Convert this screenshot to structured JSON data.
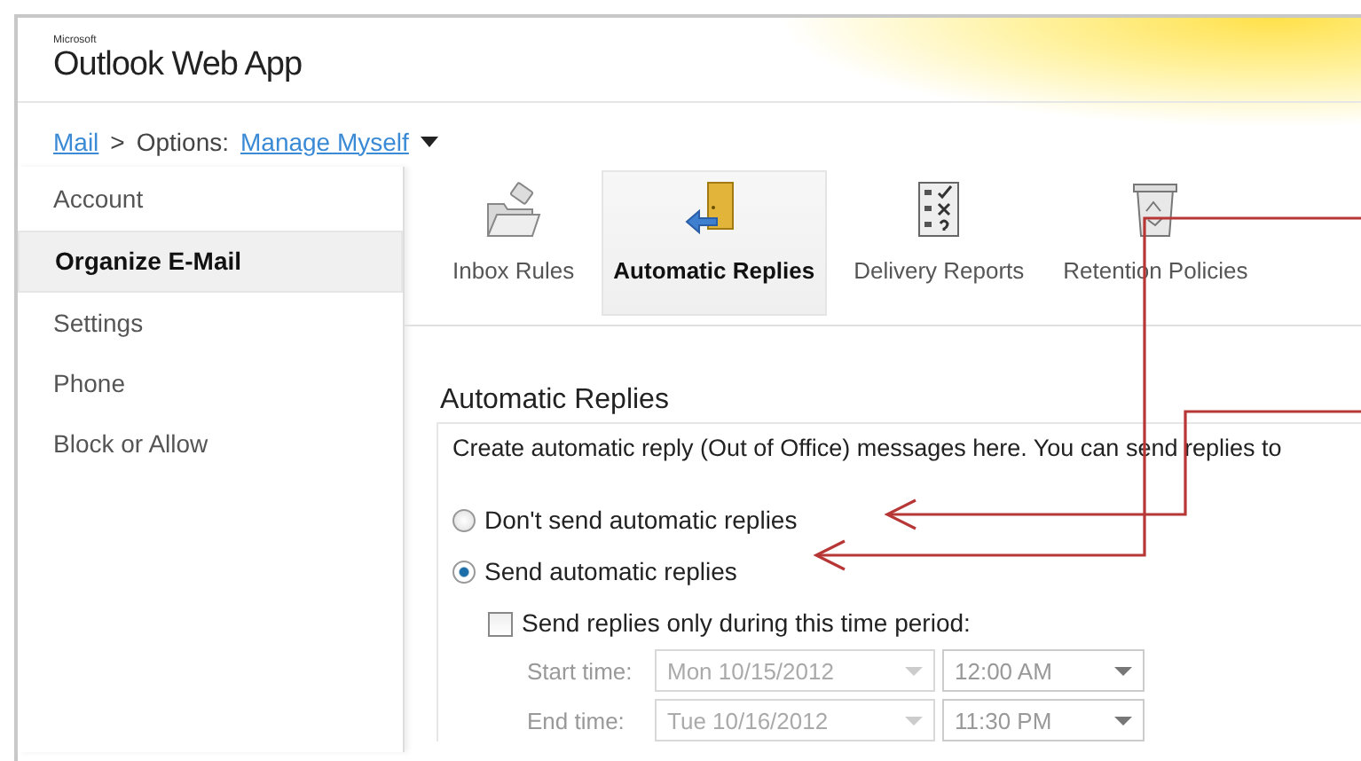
{
  "header": {
    "brand_small": "Microsoft",
    "brand": "Outlook Web App"
  },
  "breadcrumb": {
    "home": "Mail",
    "separator": ">",
    "label": "Options:",
    "current": "Manage Myself"
  },
  "sidebar": {
    "items": [
      {
        "label": "Account",
        "selected": false
      },
      {
        "label": "Organize E-Mail",
        "selected": true
      },
      {
        "label": "Settings",
        "selected": false
      },
      {
        "label": "Phone",
        "selected": false
      },
      {
        "label": "Block or Allow",
        "selected": false
      }
    ]
  },
  "toolbar": {
    "items": [
      {
        "label": "Inbox Rules",
        "kind": "folder",
        "selected": false
      },
      {
        "label": "Automatic Replies",
        "kind": "door",
        "selected": true
      },
      {
        "label": "Delivery Reports",
        "kind": "checklist",
        "selected": false
      },
      {
        "label": "Retention Policies",
        "kind": "bin",
        "selected": false
      }
    ]
  },
  "section": {
    "title": "Automatic Replies",
    "description": "Create automatic reply (Out of Office) messages here. You can send replies to",
    "options": [
      {
        "label": "Don't send automatic replies",
        "selected": false
      },
      {
        "label": "Send automatic replies",
        "selected": true
      }
    ],
    "time_period": {
      "label": "Send replies only during this time period:",
      "checked": false,
      "rows": [
        {
          "label": "Start time:",
          "date": "Mon 10/15/2012",
          "time": "12:00 AM",
          "disabled": true
        },
        {
          "label": "End time:",
          "date": "Tue 10/16/2012",
          "time": "11:30 PM",
          "disabled": true
        }
      ]
    }
  }
}
